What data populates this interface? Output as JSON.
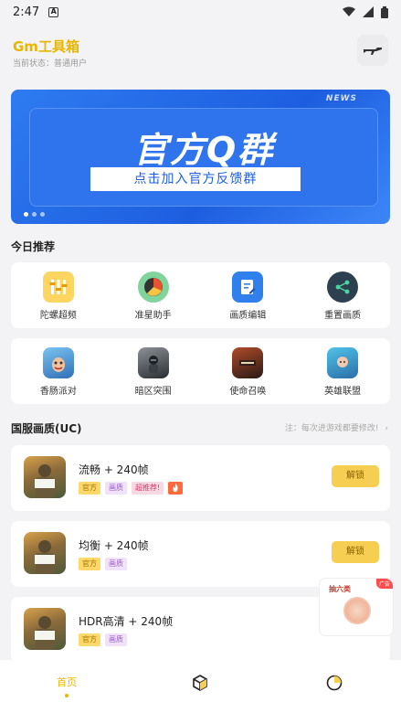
{
  "status_bar": {
    "time": "2:47",
    "sim_label": "A"
  },
  "header": {
    "title": "Gm工具箱",
    "status": "当前状态：普通用户"
  },
  "banner": {
    "badge": "NEWS",
    "headline": "官方Q群",
    "cta": "点击加入官方反馈群",
    "colors": {
      "primary": "#1d5ee0"
    }
  },
  "today": {
    "title": "今日推荐",
    "row1": [
      {
        "label": "陀螺超频",
        "icon": "tuning-sliders-icon"
      },
      {
        "label": "准星助手",
        "icon": "crosshair-pie-icon"
      },
      {
        "label": "画质编辑",
        "icon": "document-edit-icon"
      },
      {
        "label": "重置画质",
        "icon": "share-node-icon"
      }
    ],
    "row2": [
      {
        "label": "香肠派对",
        "icon": "sausage-party-game-icon"
      },
      {
        "label": "暗区突围",
        "icon": "arena-breakout-game-icon"
      },
      {
        "label": "使命召唤",
        "icon": "call-of-duty-game-icon"
      },
      {
        "label": "英雄联盟",
        "icon": "league-of-legends-game-icon"
      }
    ]
  },
  "uc_section": {
    "title": "国服画质(UC)",
    "note": "注：每次进游戏都要修改!",
    "items": [
      {
        "name": "流畅 + 240帧",
        "tags": [
          "官方",
          "画质",
          "超推荐!"
        ],
        "hot": true,
        "action": "解锁"
      },
      {
        "name": "均衡 + 240帧",
        "tags": [
          "官方",
          "画质"
        ],
        "hot": false,
        "action": "解锁"
      },
      {
        "name": "HDR高清 + 240帧",
        "tags": [
          "官方",
          "画质"
        ],
        "hot": false,
        "action": "解锁"
      }
    ]
  },
  "float_ad": {
    "title": "抽六类",
    "tag": "广告"
  },
  "tabs": [
    {
      "label": "首页",
      "icon": "home-icon",
      "active": true
    },
    {
      "label": "",
      "icon": "cube-box-icon",
      "active": false
    },
    {
      "label": "",
      "icon": "pie-chart-icon",
      "active": false
    }
  ],
  "accent_color": "#e8b600"
}
